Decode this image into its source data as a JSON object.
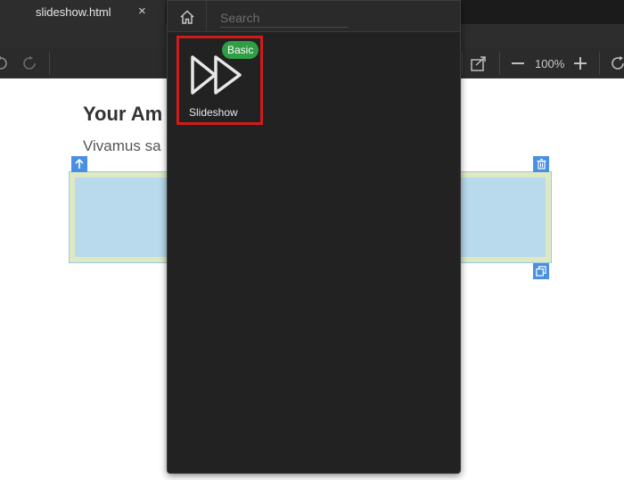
{
  "tab": {
    "title": "slideshow.html",
    "close": "×"
  },
  "toolbar": {
    "zoom_level": "100%"
  },
  "page": {
    "heading": "Your Am",
    "paragraph": "Vivamus sa"
  },
  "panel": {
    "search_placeholder": "Search",
    "items": [
      {
        "label": "Slideshow",
        "badge": "Basic",
        "icon": "fast-forward-icon"
      }
    ]
  },
  "colors": {
    "badge": "#2f9e44",
    "selection": "#d11b1b",
    "handle": "#4a90e2",
    "block_fill": "#b9d9ec",
    "block_border": "#dde9c2"
  }
}
